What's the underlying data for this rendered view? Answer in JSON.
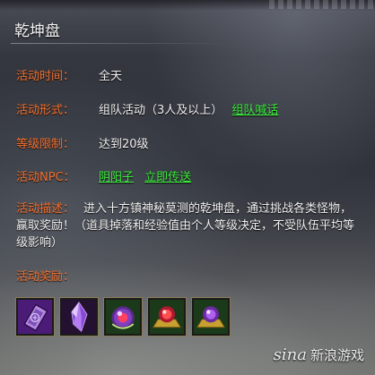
{
  "panel": {
    "title": "乾坤盘",
    "rows": {
      "time": {
        "label": "活动时间：",
        "value": "全天"
      },
      "form": {
        "label": "活动形式：",
        "value": "组队活动（3人及以上）",
        "link": "组队喊话"
      },
      "level": {
        "label": "等级限制：",
        "value": "达到20级"
      },
      "npc": {
        "label": "活动NPC：",
        "npc_link": "阴阳子",
        "teleport_link": "立即传送"
      }
    },
    "description": {
      "label": "活动描述：",
      "text": "进入十方镇神秘莫测的乾坤盘，通过挑战各类怪物，赢取奖励！（道具掉落和经验值由个人等级决定，不受队伍平均等级影响）"
    },
    "rewards": {
      "label": "活动奖励：",
      "items": [
        {
          "icon": "scroll-card-icon",
          "bg": "#5a2a8a"
        },
        {
          "icon": "purple-crystal-icon",
          "bg": "#3a1a5a"
        },
        {
          "icon": "magic-orb-icon",
          "bg": "#1e4a1e"
        },
        {
          "icon": "red-orb-gold-base-icon",
          "bg": "#1e4a1e"
        },
        {
          "icon": "purple-orb-gold-base-icon",
          "bg": "#1e4a1e"
        }
      ]
    }
  },
  "watermark": {
    "brand": "sina",
    "text": "新浪游戏"
  },
  "colors": {
    "label": "#f07030",
    "link": "#3cf03c",
    "text": "#f2f2f2"
  }
}
